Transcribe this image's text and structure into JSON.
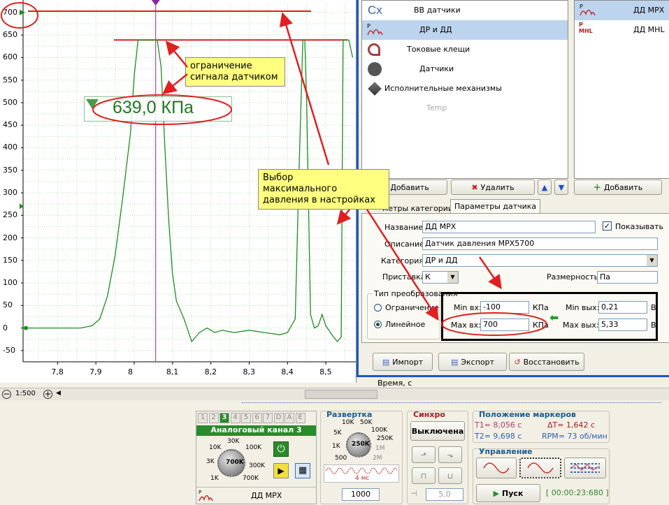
{
  "chart_data": {
    "type": "line",
    "xlabel": "Время, с",
    "x_ticks": [
      "7,8",
      "7,9",
      "8",
      "8,1",
      "8,2",
      "8,3",
      "8,4",
      "8,5"
    ],
    "y_ticks": [
      "700",
      "650",
      "600",
      "550",
      "500",
      "450",
      "400",
      "350",
      "300",
      "250",
      "200",
      "150",
      "100",
      "50",
      "0",
      "-50"
    ],
    "ylim": [
      -75,
      720
    ],
    "xlim": [
      7.71,
      8.58
    ],
    "grid": true,
    "series": [
      {
        "color": "#1e8c1e",
        "x": [
          7.71,
          7.86,
          7.89,
          7.91,
          7.93,
          7.95,
          7.97,
          7.99,
          8.0,
          8.01,
          8.02,
          8.04,
          8.05,
          8.06,
          8.07,
          8.08,
          8.09,
          8.1,
          8.11,
          8.13,
          8.15,
          8.17,
          8.19,
          8.2,
          8.21,
          8.23,
          8.26,
          8.3,
          8.34,
          8.38,
          8.4,
          8.42,
          8.43,
          8.44,
          8.445,
          8.45,
          8.46,
          8.47,
          8.48,
          8.49,
          8.5,
          8.52,
          8.53,
          8.54,
          8.545,
          8.55,
          8.56,
          8.57
        ],
        "y": [
          0,
          0,
          5,
          20,
          70,
          160,
          290,
          430,
          560,
          639,
          639,
          639,
          639,
          639,
          580,
          400,
          240,
          120,
          60,
          20,
          -30,
          -10,
          0,
          -5,
          -10,
          -5,
          -10,
          -5,
          -10,
          -15,
          -10,
          20,
          350,
          639,
          639,
          500,
          30,
          0,
          5,
          30,
          5,
          -20,
          -30,
          -20,
          639,
          639,
          639,
          600
        ]
      }
    ],
    "value_label": "639,0 КПа",
    "marker_x": 8.056
  },
  "annotations": {
    "limit": [
      "ограничение",
      "сигнала датчиком"
    ],
    "select": [
      "Выбор",
      "максимального",
      "давления в настройках"
    ]
  },
  "dialog": {
    "categories": [
      {
        "icon": "Cx",
        "label": "ВВ датчики"
      },
      {
        "icon": "pressure-icon",
        "label": "ДР и ДД",
        "selected": true
      },
      {
        "icon": "clamp-icon",
        "label": "Токовые клещи"
      },
      {
        "icon": "sensor-icon",
        "label": "Датчики"
      },
      {
        "icon": "actuator-icon",
        "label": "Исполнительные механизмы"
      },
      {
        "icon": "",
        "label": "Temp",
        "disabled": true
      }
    ],
    "sensors": [
      {
        "label": "ДД MPX",
        "selected": true
      },
      {
        "label": "ДД MHL"
      }
    ],
    "add_label": "Добавить",
    "delete_label": "Удалить",
    "add2_label": "Добавить",
    "tab_category": "метры категории",
    "tab_sensor": "Параметры датчика",
    "name_label": "Название:",
    "name_value": "ДД MPX",
    "show_label": "Показывать",
    "desc_label": "Описание:",
    "desc_value": "Датчик давления MPX5700",
    "cat_label": "Категория:",
    "cat_value": "ДР и ДД",
    "prefix_label": "Приставка:",
    "prefix_value": "К",
    "dim_label": "Размерность:",
    "dim_value": "Па",
    "conv_title": "Тип преобразования",
    "radio_limit": "Ограничение",
    "radio_linear": "Линейное",
    "min_in_label": "Min вх:",
    "min_in_value": "-100",
    "max_in_label": "Max вх:",
    "max_in_value": "700",
    "unit_kpa": "КПа",
    "min_out_label": "Min вых:",
    "min_out_value": "0,21",
    "max_out_label": "Max вых:",
    "max_out_value": "5,33",
    "unit_v": "В",
    "import_label": "Импорт",
    "export_label": "Экспорт",
    "restore_label": "Восстановить"
  },
  "scale": {
    "zoom": "1:500",
    "time_label": "Время, с"
  },
  "bottom": {
    "channel_tabs": [
      "1",
      "2",
      "3",
      "4",
      "5",
      "6",
      "7",
      "D",
      "A",
      "E"
    ],
    "channel_title": "Аналоговый канал 3",
    "knob1_labels": [
      "30K",
      "10K",
      "100K",
      "3K",
      "300K",
      "1K",
      "700K"
    ],
    "knob1_center": "700K",
    "sensor_name": "ДД MPX",
    "sweep_title": "Развертка",
    "knob2_labels": [
      "10K",
      "50K",
      "5K",
      "100K",
      "250K",
      "1K",
      "1M",
      "500",
      "2M"
    ],
    "knob2_center": "250K",
    "sweep_time": "4 мс",
    "sweep_value": "1000",
    "sync_title": "Синхро",
    "sync_value": "Выключена",
    "sync_level": "5,0",
    "markers_title": "Положение маркеров",
    "t1": "T1= 8,056 с",
    "t2": "T2= 9,698 с",
    "dt": "ΔT= 1,642 с",
    "rpm": "RPM= 73 об/мин",
    "control_title": "Управление",
    "start_label": "Пуск",
    "timer": "[ 00:00:23:680 ]"
  }
}
